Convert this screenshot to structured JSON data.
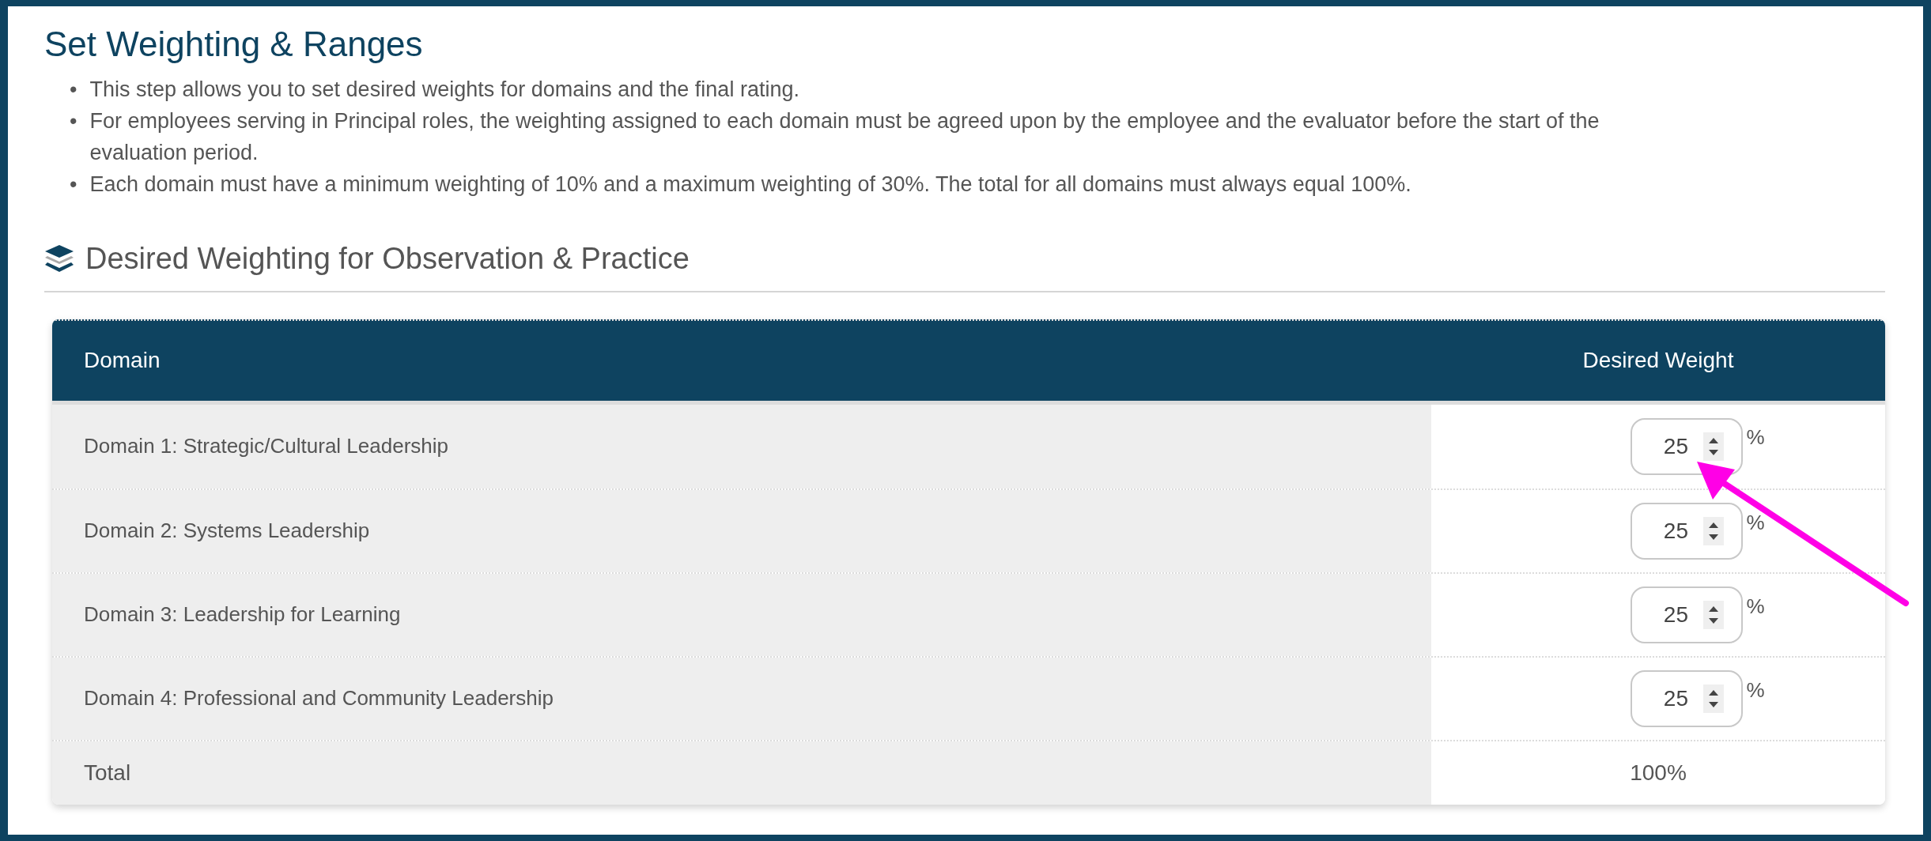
{
  "title": "Set Weighting & Ranges",
  "bullets": [
    {
      "marker": "•",
      "text": "This step allows you to set desired weights for domains and the final rating."
    },
    {
      "marker": "•",
      "text": "For employees serving in Principal roles, the weighting assigned to each domain must be agreed upon by the employee and the evaluator before the start of the evaluation period."
    },
    {
      "marker": "•",
      "text": "Each domain must have a minimum weighting of 10% and a maximum weighting of 30%. The total for all domains must always equal 100%."
    }
  ],
  "section": {
    "title": "Desired Weighting for Observation & Practice"
  },
  "table": {
    "columns": [
      "Domain",
      "Desired Weight"
    ],
    "rows": [
      {
        "domain": "Domain 1: Strategic/Cultural Leadership",
        "weight": "25",
        "unit": "%"
      },
      {
        "domain": "Domain 2: Systems Leadership",
        "weight": "25",
        "unit": "%"
      },
      {
        "domain": "Domain 3: Leadership for Learning",
        "weight": "25",
        "unit": "%"
      },
      {
        "domain": "Domain 4: Professional and Community Leadership",
        "weight": "25",
        "unit": "%"
      }
    ],
    "total": {
      "label": "Total",
      "value": "100%"
    }
  }
}
